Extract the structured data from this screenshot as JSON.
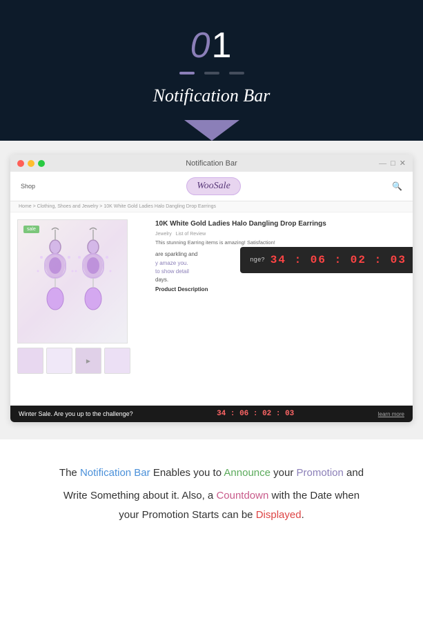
{
  "hero": {
    "number_zero": "0",
    "number_one": "1",
    "title": "Notification Bar",
    "dots": [
      "active",
      "inactive",
      "inactive"
    ]
  },
  "browser": {
    "title": "Notification Bar",
    "window_controls": [
      "—",
      "□",
      "✕"
    ]
  },
  "store": {
    "nav_left": "Shop",
    "logo": "WooSale",
    "search_icon": "search"
  },
  "breadcrumb": "Home > Clothing, Shoes and Jewelry > 10K White Gold Ladies Halo Dangling Drop Earrings",
  "product": {
    "title": "10K White Gold Ladies Halo Dangling Drop Earrings",
    "meta_left": "Jewelry",
    "meta_center": "List of Review",
    "description": "This stunning Earring items is amazing! Satisfaction!",
    "sale_badge": "sale",
    "countdown_question": "nge?",
    "countdown_time": "34 : 06 : 02 : 03",
    "hover_text": "are sparkling and",
    "amaze_text": "y amaze you.",
    "to_show_detail": "to show detail",
    "days_text": "days.",
    "description_label": "Product Description"
  },
  "notification_bar": {
    "text": "Winter Sale. Are you up to the challenge?",
    "timer": "34 : 06 : 02 : 03",
    "link": "learn more"
  },
  "bottom_text": {
    "line1_prefix": "The ",
    "notification_bar": "Notification Bar",
    "line1_mid": " Enables you to  ",
    "announce": "Announce",
    "line1_suf1": " your ",
    "promotion1": "Promotion",
    "line1_suf2": " and",
    "line2": "Write Something about it.  Also, a ",
    "countdown": "Countdown",
    "line2_mid": " with the Date when",
    "line3_prefix": "your Promotion Starts can be ",
    "displayed": "Displayed",
    "line3_suf": "."
  }
}
